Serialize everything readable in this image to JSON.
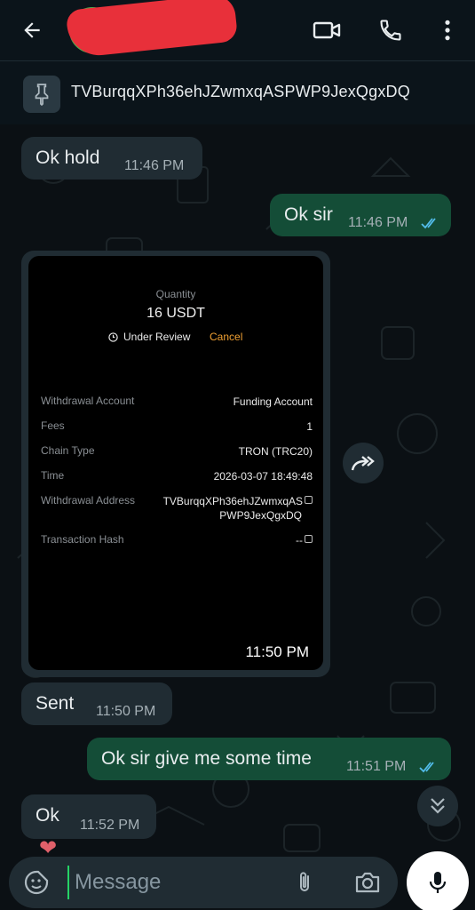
{
  "header": {
    "contact_name": "",
    "icons": [
      "back-arrow-icon",
      "video-call-icon",
      "voice-call-icon",
      "more-options-icon"
    ]
  },
  "pinned": {
    "text": "TVBurqqXPh36ehJZwmxqASPWP9JexQgxDQ",
    "icon": "pin-icon"
  },
  "messages": [
    {
      "direction": "in",
      "text": "Ok hold",
      "time": "11:46 PM"
    },
    {
      "direction": "out",
      "text": "Ok sir",
      "time": "11:46 PM",
      "status": "read"
    },
    {
      "direction": "in",
      "type": "image",
      "time": "11:50 PM"
    },
    {
      "direction": "in",
      "text": "Sent",
      "time": "11:50 PM"
    },
    {
      "direction": "out",
      "text": "Ok sir give me some time",
      "time": "11:51 PM",
      "status": "read"
    },
    {
      "direction": "in",
      "text": "Ok",
      "time": "11:52 PM"
    }
  ],
  "card": {
    "quantity_label": "Quantity",
    "quantity": "16 USDT",
    "status": "Under Review",
    "cancel": "Cancel",
    "rows": [
      {
        "label": "Withdrawal Account",
        "value": "Funding Account"
      },
      {
        "label": "Fees",
        "value": "1"
      },
      {
        "label": "Chain Type",
        "value": "TRON (TRC20)"
      },
      {
        "label": "Time",
        "value": "2026-03-07 18:49:48"
      },
      {
        "label": "Withdrawal Address",
        "value_line1": "TVBurqqXPh36ehJZwmxqAS",
        "value_line2": "PWP9JexQgxDQ"
      },
      {
        "label": "Transaction Hash",
        "value": "--"
      }
    ]
  },
  "input": {
    "placeholder": "Message"
  },
  "colors": {
    "background": "#0b141a",
    "incoming_bubble": "#202c33",
    "outgoing_bubble": "#144d37",
    "read_ticks": "#53bdeb",
    "cancel_accent": "#f0a032"
  }
}
